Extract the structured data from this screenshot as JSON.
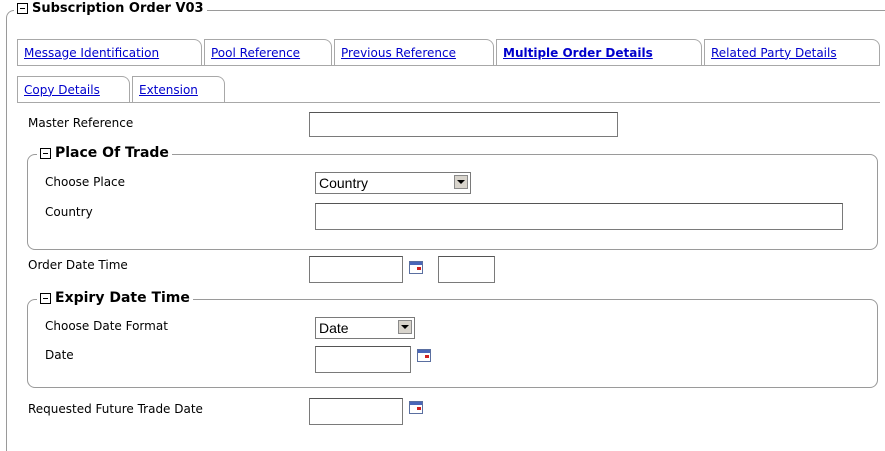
{
  "form": {
    "title": "Subscription Order V03"
  },
  "tabs": [
    {
      "label": "Message Identification"
    },
    {
      "label": "Pool Reference"
    },
    {
      "label": "Previous Reference"
    },
    {
      "label": "Multiple Order Details",
      "active": true
    },
    {
      "label": "Related Party Details"
    },
    {
      "label": "Copy Details"
    },
    {
      "label": "Extension"
    }
  ],
  "fields": {
    "master_reference": {
      "label": "Master Reference",
      "value": ""
    },
    "order_date_time": {
      "label": "Order Date Time",
      "date": "",
      "time": ""
    },
    "requested_future_trade_date": {
      "label": "Requested Future Trade Date",
      "value": ""
    }
  },
  "place_of_trade": {
    "title": "Place Of Trade",
    "choose_label": "Choose Place",
    "choose_value": "Country",
    "country_label": "Country",
    "country_value": ""
  },
  "expiry_date_time": {
    "title": "Expiry Date Time",
    "choose_label": "Choose Date Format",
    "choose_value": "Date",
    "date_label": "Date",
    "date_value": ""
  },
  "icons": {
    "calendar": "calendar-icon",
    "collapse": "collapse-icon",
    "dropdown": "chevron-down-icon"
  }
}
